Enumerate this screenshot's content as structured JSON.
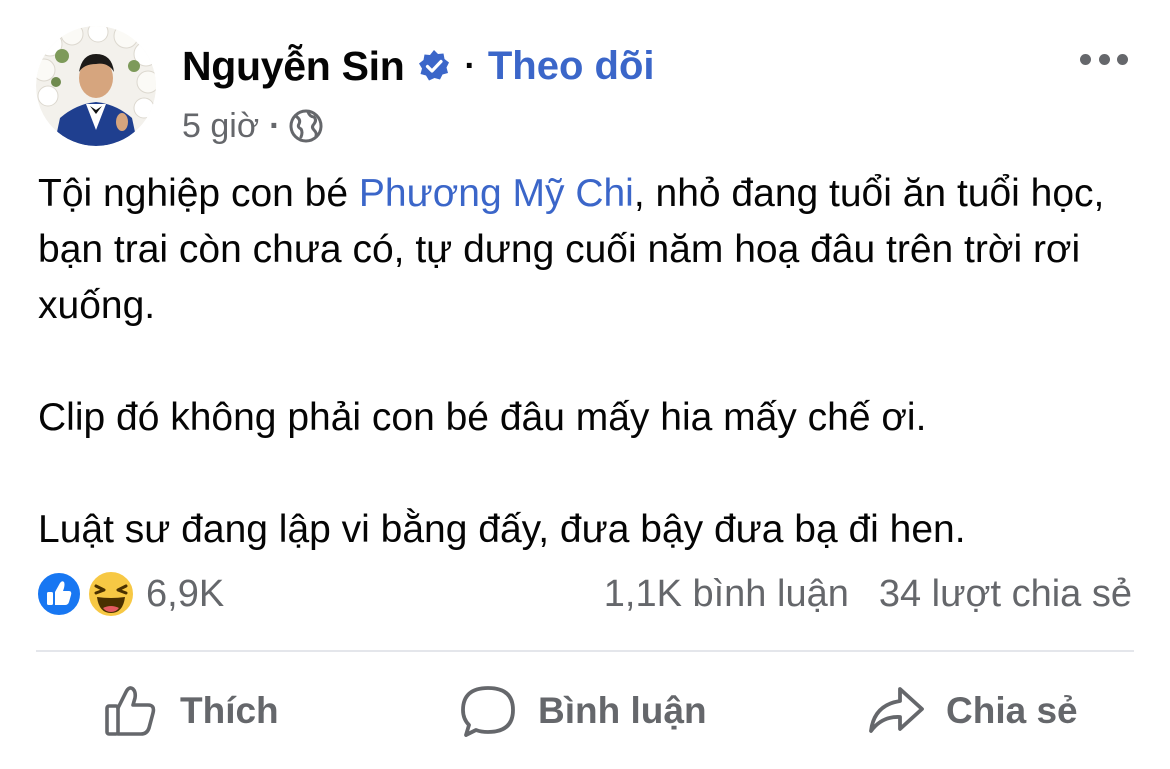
{
  "post": {
    "author": {
      "name": "Nguyễn Sin",
      "verified_icon": "verified-badge-icon",
      "separator": "·",
      "follow_label": "Theo dõi"
    },
    "meta": {
      "time": "5 giờ",
      "separator": "·",
      "privacy_icon": "globe-icon"
    },
    "body": {
      "p1_before": "Tội nghiệp con bé ",
      "p1_mention": "Phương Mỹ Chi",
      "p1_after": ", nhỏ đang tuổi ăn tuổi học, bạn trai còn chưa có, tự dưng cuối năm hoạ đâu trên trời rơi xuống.",
      "p2": "Clip đó không phải con bé đâu mấy hia mấy chế ơi.",
      "p3": "Luật sư đang lập vi bằng đấy, đưa bậy đưa bạ đi hen."
    },
    "stats": {
      "reactions": "6,9K",
      "reaction_icons": [
        "like-icon",
        "haha-icon"
      ],
      "comments": "1,1K bình luận",
      "shares": "34 lượt chia sẻ"
    },
    "actions": {
      "like_label": "Thích",
      "comment_label": "Bình luận",
      "share_label": "Chia sẻ"
    }
  },
  "colors": {
    "link_blue": "#3b66c9",
    "secondary_text": "#65676b",
    "primary_text": "#050505",
    "divider": "#e4e6eb",
    "like_blue": "#1877f2",
    "haha_yellow": "#f7c844"
  }
}
